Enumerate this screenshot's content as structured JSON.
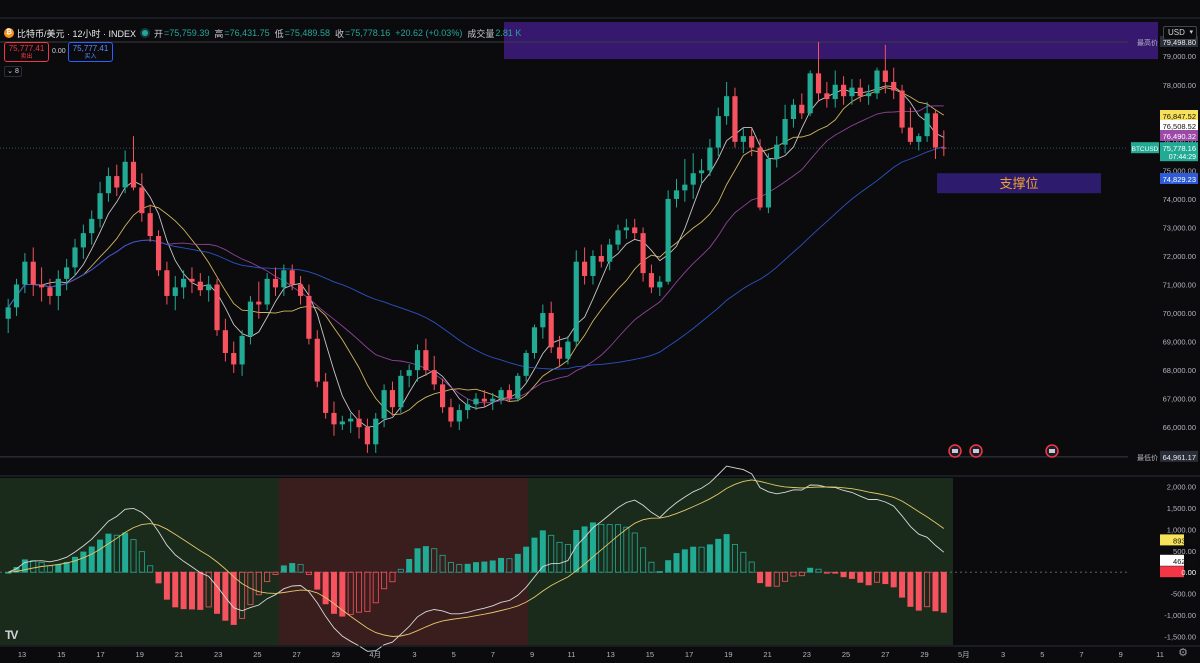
{
  "header": {
    "symbol_title": "比特币/美元 · 12小时 · INDEX",
    "open_label": "开",
    "open_value": "=75,759.39",
    "high_label": "高",
    "high_value": "=76,431.75",
    "low_label": "低",
    "low_value": "=75,489.58",
    "close_label": "收",
    "close_value": "=75,778.16",
    "change": "+20.62 (+0.03%)",
    "volume_label": "成交量",
    "volume_value": "2.81 K"
  },
  "trade": {
    "sell_price": "75,777.41",
    "sell_label": "卖出",
    "spread": "0.00",
    "buy_price": "75,777.41",
    "buy_label": "买入"
  },
  "indicator_count": "8",
  "currency_select": "USD",
  "price_axis": {
    "ticks": [
      "79,000.00",
      "78,000.00",
      "77,000.00",
      "76,000.00",
      "75,000.00",
      "74,000.00",
      "73,000.00",
      "72,000.00",
      "71,000.00",
      "70,000.00",
      "69,000.00",
      "68,000.00",
      "67,000.00",
      "66,000.00"
    ],
    "tick_values": [
      79000,
      78000,
      77000,
      76000,
      75000,
      74000,
      73000,
      72000,
      71000,
      70000,
      69000,
      68000,
      67000,
      66000
    ],
    "high_label": "最高价",
    "high_value": "79,498.80",
    "low_label": "最低价",
    "low_value": "64,961.17",
    "ma1_label": "76,847.52",
    "ma2_label": "76,508.52",
    "ma3_label": "76,490.32",
    "ma4_label": "74,829.23",
    "symbol_tag": "BTCUSD",
    "price_tag": "75,778.16",
    "countdown": "07:44:29"
  },
  "macd_axis": {
    "ticks": [
      "2,000.00",
      "1,500.00",
      "1,000.00",
      "500.00",
      "-500.00",
      "-1,000.00",
      "-1,500.00"
    ],
    "tick_values": [
      2000,
      1500,
      1000,
      500,
      -500,
      -1000,
      -1500
    ],
    "label1": "893.59",
    "label2": "462.41",
    "label3": "0.00"
  },
  "time_axis": {
    "labels": [
      "13",
      "15",
      "17",
      "19",
      "21",
      "23",
      "25",
      "27",
      "29",
      "4月",
      "3",
      "5",
      "7",
      "9",
      "11",
      "13",
      "15",
      "17",
      "19",
      "21",
      "23",
      "25",
      "27",
      "29",
      "5月",
      "3",
      "5",
      "7",
      "9",
      "11"
    ]
  },
  "annotation": {
    "support_text": "支撑位"
  },
  "colors": {
    "up": "#22ab94",
    "down": "#f7525f",
    "ma_yellow": "#e6c76a",
    "ma_white": "#d9d9d9",
    "ma_purple": "#9c4aa8",
    "ma_blue": "#2f5bd8",
    "highlight_purple": "#3b1a7a",
    "support_box": "#2d1c6e",
    "support_text": "#f0a030"
  },
  "chart_data": {
    "type": "candlestick",
    "ylim": [
      64500,
      80200
    ],
    "candles": [
      [
        69800,
        70500,
        69300,
        70200
      ],
      [
        70200,
        71200,
        69900,
        71000
      ],
      [
        71000,
        72100,
        70700,
        71800
      ],
      [
        71800,
        72300,
        70600,
        71000
      ],
      [
        71000,
        71600,
        70400,
        70900
      ],
      [
        70900,
        71200,
        70300,
        70600
      ],
      [
        70600,
        71500,
        70100,
        71200
      ],
      [
        71200,
        71900,
        70800,
        71600
      ],
      [
        71600,
        72600,
        71300,
        72300
      ],
      [
        72300,
        73100,
        71900,
        72800
      ],
      [
        72800,
        73600,
        72400,
        73300
      ],
      [
        73300,
        74600,
        73000,
        74200
      ],
      [
        74200,
        75100,
        73900,
        74800
      ],
      [
        74800,
        75200,
        74100,
        74400
      ],
      [
        74400,
        75700,
        74200,
        75300
      ],
      [
        75300,
        76200,
        74300,
        74400
      ],
      [
        74400,
        74900,
        73200,
        73500
      ],
      [
        73500,
        73800,
        72500,
        72700
      ],
      [
        72700,
        72900,
        71300,
        71500
      ],
      [
        71500,
        71800,
        70300,
        70600
      ],
      [
        70600,
        71300,
        70100,
        70900
      ],
      [
        70900,
        71500,
        70500,
        71200
      ],
      [
        71200,
        71600,
        70700,
        71100
      ],
      [
        71100,
        71400,
        70600,
        70800
      ],
      [
        70800,
        71300,
        70400,
        71000
      ],
      [
        71000,
        71200,
        69200,
        69400
      ],
      [
        69400,
        69800,
        68300,
        68600
      ],
      [
        68600,
        69000,
        67900,
        68200
      ],
      [
        68200,
        69400,
        67800,
        69200
      ],
      [
        69200,
        70600,
        68900,
        70400
      ],
      [
        70400,
        71100,
        69800,
        70300
      ],
      [
        70300,
        71400,
        70100,
        71200
      ],
      [
        71200,
        71600,
        70600,
        70900
      ],
      [
        70900,
        71700,
        70600,
        71500
      ],
      [
        71500,
        71700,
        70800,
        71000
      ],
      [
        71000,
        71300,
        70300,
        70600
      ],
      [
        70600,
        71000,
        68900,
        69100
      ],
      [
        69100,
        69400,
        67400,
        67600
      ],
      [
        67600,
        67900,
        66300,
        66500
      ],
      [
        66500,
        66900,
        65700,
        66100
      ],
      [
        66100,
        66400,
        65900,
        66200
      ],
      [
        66200,
        66500,
        65800,
        66300
      ],
      [
        66300,
        66600,
        65600,
        66000
      ],
      [
        66000,
        66300,
        65100,
        65400
      ],
      [
        65400,
        66500,
        65100,
        66300
      ],
      [
        66300,
        67500,
        66000,
        67300
      ],
      [
        67300,
        67600,
        66400,
        66700
      ],
      [
        66700,
        68000,
        66500,
        67800
      ],
      [
        67800,
        68200,
        67400,
        68000
      ],
      [
        68000,
        68900,
        67600,
        68700
      ],
      [
        68700,
        69100,
        67800,
        68000
      ],
      [
        68000,
        68500,
        67300,
        67500
      ],
      [
        67500,
        67700,
        66500,
        66700
      ],
      [
        66700,
        67000,
        66000,
        66200
      ],
      [
        66200,
        66800,
        65900,
        66600
      ],
      [
        66600,
        67000,
        66300,
        66800
      ],
      [
        66800,
        67200,
        66600,
        67000
      ],
      [
        67000,
        67300,
        66700,
        66900
      ],
      [
        66900,
        67200,
        66600,
        67000
      ],
      [
        67000,
        67400,
        66800,
        67300
      ],
      [
        67300,
        67500,
        66900,
        67000
      ],
      [
        67000,
        67900,
        66900,
        67800
      ],
      [
        67800,
        68700,
        67600,
        68600
      ],
      [
        68600,
        69600,
        68400,
        69500
      ],
      [
        69500,
        70300,
        69100,
        70000
      ],
      [
        70000,
        70400,
        68600,
        68800
      ],
      [
        68800,
        69200,
        68100,
        68400
      ],
      [
        68400,
        69200,
        68200,
        69000
      ],
      [
        69000,
        72200,
        68800,
        71800
      ],
      [
        71800,
        72300,
        71000,
        71300
      ],
      [
        71300,
        72200,
        71000,
        72000
      ],
      [
        72000,
        72400,
        71600,
        71800
      ],
      [
        71800,
        72600,
        71500,
        72400
      ],
      [
        72400,
        73100,
        72200,
        72900
      ],
      [
        72900,
        73300,
        72600,
        73000
      ],
      [
        73000,
        73300,
        72600,
        72800
      ],
      [
        72800,
        73000,
        71100,
        71400
      ],
      [
        71400,
        71700,
        70700,
        70900
      ],
      [
        70900,
        71300,
        70600,
        71100
      ],
      [
        71100,
        74300,
        71000,
        74000
      ],
      [
        74000,
        74700,
        73700,
        74300
      ],
      [
        74300,
        75400,
        73900,
        74500
      ],
      [
        74500,
        75600,
        74000,
        74900
      ],
      [
        74900,
        75400,
        74500,
        75000
      ],
      [
        75000,
        76100,
        74800,
        75800
      ],
      [
        75800,
        77200,
        75500,
        76900
      ],
      [
        76900,
        78100,
        76600,
        77600
      ],
      [
        77600,
        77900,
        75800,
        76000
      ],
      [
        76000,
        76500,
        75600,
        76200
      ],
      [
        76200,
        76500,
        75500,
        75800
      ],
      [
        75800,
        76100,
        73600,
        73700
      ],
      [
        73700,
        75600,
        73500,
        75400
      ],
      [
        75400,
        76200,
        75100,
        75900
      ],
      [
        75900,
        77300,
        75600,
        76800
      ],
      [
        76800,
        77500,
        76500,
        77300
      ],
      [
        77300,
        77700,
        76800,
        77000
      ],
      [
        77000,
        78500,
        76900,
        78400
      ],
      [
        78400,
        79500,
        77400,
        77700
      ],
      [
        77700,
        78100,
        77200,
        77500
      ],
      [
        77500,
        78500,
        77200,
        78000
      ],
      [
        78000,
        78300,
        77300,
        77600
      ],
      [
        77600,
        78200,
        77300,
        77900
      ],
      [
        77900,
        78200,
        77400,
        77600
      ],
      [
        77600,
        78000,
        77300,
        77700
      ],
      [
        77700,
        78600,
        77500,
        78500
      ],
      [
        78500,
        79400,
        77700,
        78100
      ],
      [
        78100,
        78600,
        77500,
        77800
      ],
      [
        77800,
        78000,
        76300,
        76500
      ],
      [
        76500,
        77200,
        75900,
        76000
      ],
      [
        76000,
        76300,
        75700,
        76200
      ],
      [
        76200,
        77400,
        76000,
        77000
      ],
      [
        77000,
        77100,
        75400,
        75800
      ],
      [
        75800,
        76400,
        75500,
        75778
      ]
    ]
  }
}
